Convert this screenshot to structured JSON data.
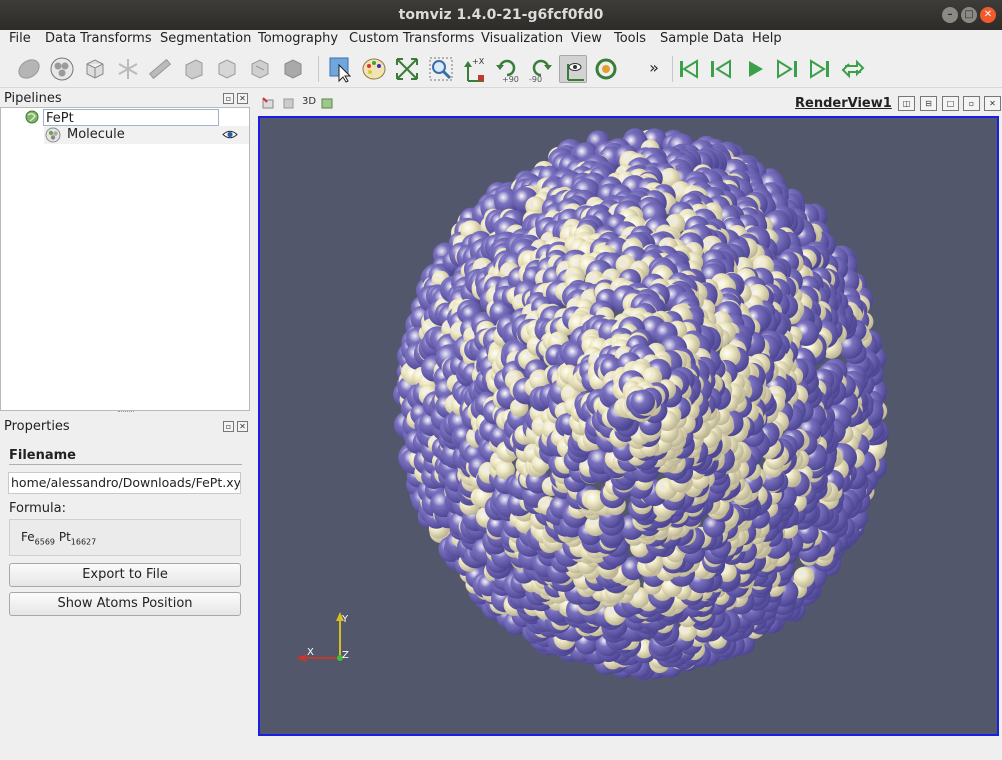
{
  "window": {
    "title": "tomviz 1.4.0-21-g6fcf0fd0"
  },
  "menu": [
    "File",
    "Data Transforms",
    "Segmentation",
    "Tomography",
    "Custom Transforms",
    "Visualization",
    "View",
    "Tools",
    "Sample Data",
    "Help"
  ],
  "toolbar": {
    "more_label": "»",
    "rotate_plus": "+90",
    "rotate_minus": "-90",
    "axis_label": "+X"
  },
  "pipelines": {
    "title": "Pipelines",
    "items": [
      {
        "label": "FePt",
        "icon": "globe-icon",
        "selected": true
      },
      {
        "label": "Molecule",
        "icon": "molecule-icon",
        "visible": true
      }
    ]
  },
  "properties": {
    "title": "Properties",
    "filename_heading": "Filename",
    "filename_value": "home/alessandro/Downloads/FePt.xyz",
    "formula_label": "Formula:",
    "formula": {
      "el1": "Fe",
      "n1": "6569",
      "el2": "Pt",
      "n2": "16627"
    },
    "export_button": "Export to File",
    "show_atoms_button": "Show Atoms Position"
  },
  "view": {
    "title": "RenderView1",
    "mode_3d": "3D",
    "background": "#52576c",
    "atom_colors": {
      "Fe": "#7b72c0",
      "Pt": "#f2ecc8"
    },
    "axes": {
      "x": "X",
      "y": "Y",
      "z": "Z"
    }
  }
}
